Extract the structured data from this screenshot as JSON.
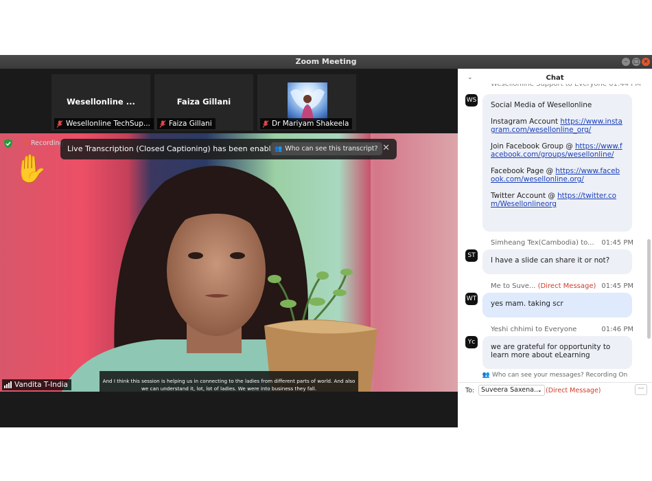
{
  "window": {
    "title": "Zoom Meeting"
  },
  "gallery": [
    {
      "display": "Wesellonline ...",
      "name": "Wesellonline TechSup..."
    },
    {
      "display": "Faiza Gillani",
      "name": "Faiza Gillani"
    },
    {
      "display": "",
      "name": "Dr Mariyam Shakeela"
    }
  ],
  "video": {
    "recording": "Recording",
    "banner_text": "Live Transcription (Closed Captioning) has been enabled",
    "banner_button": "Who can see this transcript?",
    "speaker": "Vandita T-India",
    "caption": "And I think this session is helping us in connecting to the ladies from different parts of world. And also we can understand it, lot, lot of ladies. We were into business they fall.",
    "hand_emoji": "✋"
  },
  "chat": {
    "title": "Chat",
    "cut_header": "Wesellonline Support to Everyone  01:44 PM",
    "msg1": {
      "avatar": "WS",
      "heading": "Social Media of Wesellonline",
      "ig_label": "Instagram Account ",
      "ig_url": "https://www.instagram.com/wesellonline_org/",
      "fb_group_label": "Join Facebook Group @ ",
      "fb_group_url": "https://www.facebook.com/groups/wesellonline/",
      "fb_page_label": "Facebook Page @ ",
      "fb_page_url": "https://www.facebook.com/wesellonline.org/",
      "tw_label": "Twitter Account @ ",
      "tw_url": "https://twitter.com/Wesellonlineorg"
    },
    "msg2": {
      "avatar": "ST",
      "sender": "Simheang Tex(Cambodia) to...",
      "time": "01:45 PM",
      "text": "I have a slide can share it or not?"
    },
    "msg3": {
      "avatar": "WT",
      "sender": "Me to Suve...",
      "dm": "(Direct Message)",
      "time": "01:45 PM",
      "text": "yes mam. taking scr"
    },
    "msg4": {
      "avatar": "Yc",
      "sender": "Yeshi chhimi to Everyone",
      "time": "01:46 PM",
      "text": "we are grateful for opportunity to learn more about eLearning"
    },
    "visibility": "Who can see your messages? Recording On",
    "to_label": "To:",
    "to_value": "Suveera Saxena...",
    "to_dm": "(Direct Message)",
    "more": "···"
  }
}
